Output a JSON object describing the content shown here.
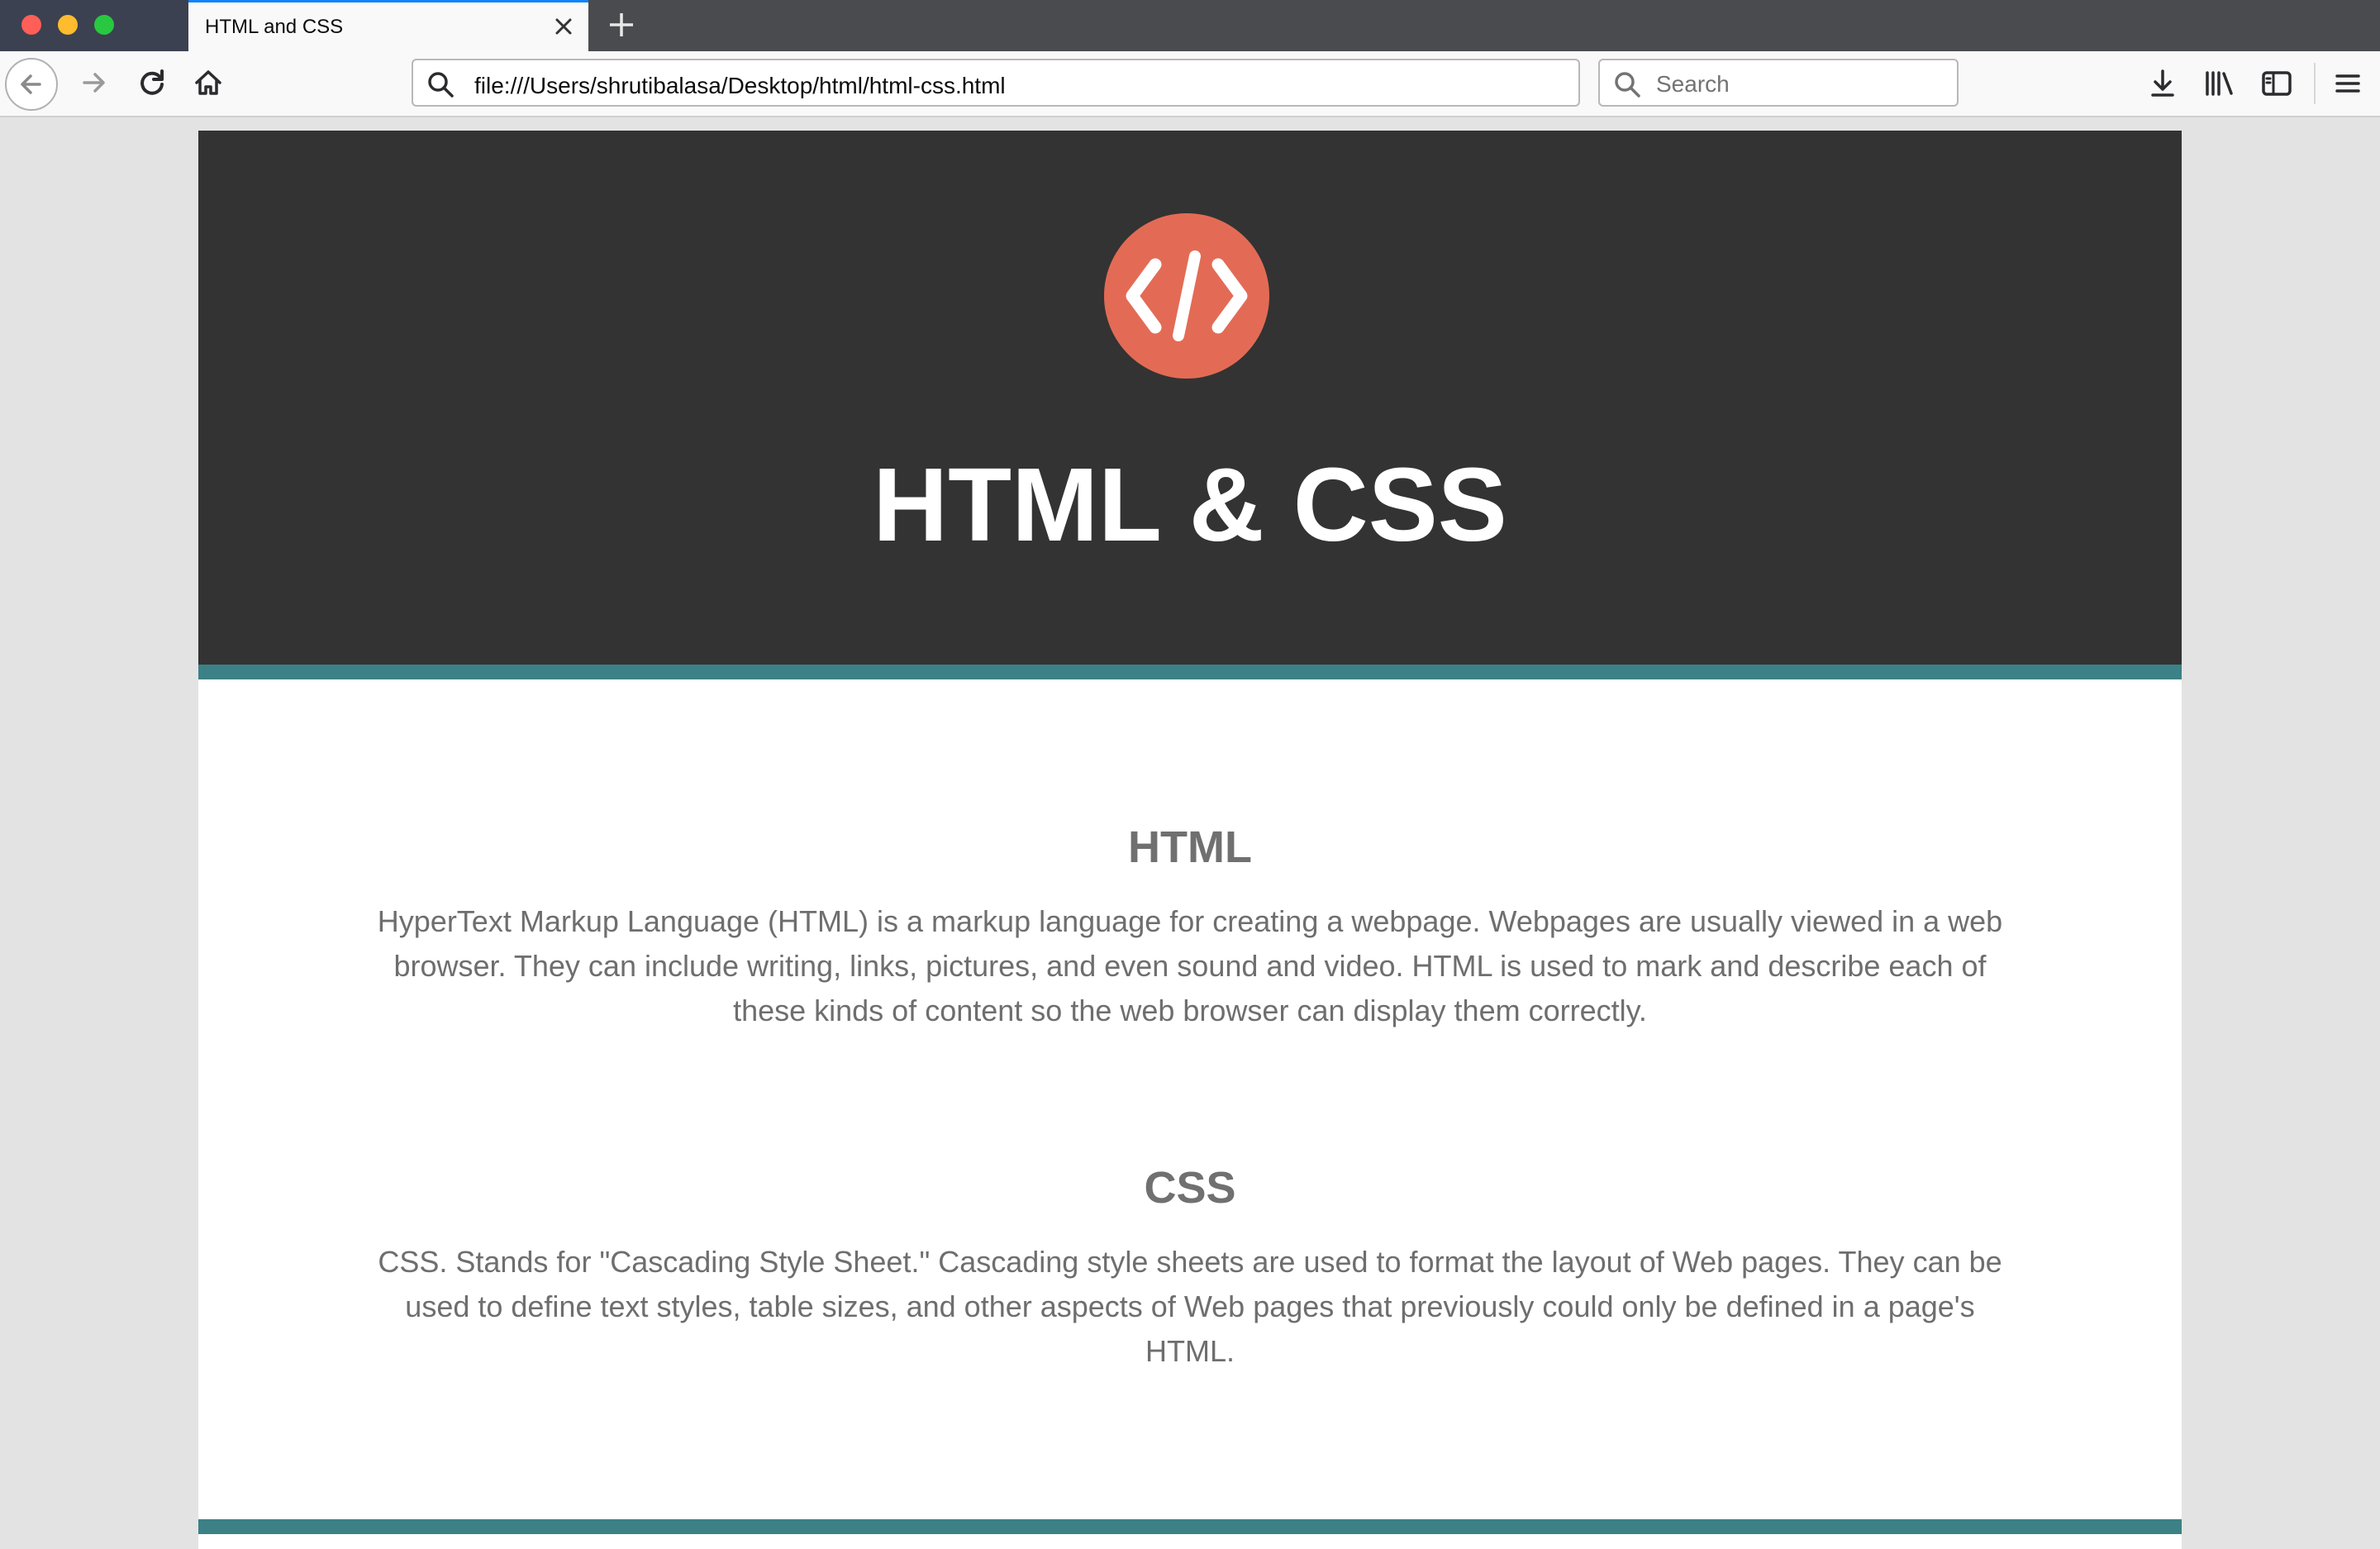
{
  "browser": {
    "tab_title": "HTML and CSS",
    "url": "file:///Users/shrutibalasa/Desktop/html/html-css.html",
    "search_placeholder": "Search"
  },
  "page": {
    "hero_title": "HTML & CSS",
    "logo_icon": "code-brackets-icon",
    "sections": [
      {
        "heading": "HTML",
        "body": "HyperText Markup Language (HTML) is a markup language for creating a webpage. Webpages are usually viewed in a web browser. They can include writing, links, pictures, and even sound and video. HTML is used to mark and describe each of these kinds of content so the web browser can display them correctly."
      },
      {
        "heading": "CSS",
        "body": "CSS. Stands for \"Cascading Style Sheet.\" Cascading style sheets are used to format the layout of Web pages. They can be used to define text styles, table sizes, and other aspects of Web pages that previously could only be defined in a page's HTML."
      }
    ]
  },
  "colors": {
    "hero_background": "#333333",
    "accent_band": "#3b8186",
    "logo_circle": "#e36b55",
    "page_background": "#e3e3e3"
  }
}
